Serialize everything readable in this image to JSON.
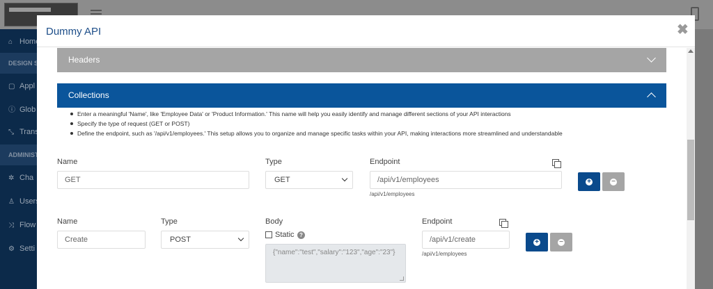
{
  "background": {
    "sidebar": {
      "items": [
        {
          "label": "Home",
          "icon": "home-icon"
        },
        {
          "label": "Appl",
          "icon": "app-icon"
        },
        {
          "label": "Glob",
          "icon": "globe-icon"
        },
        {
          "label": "Trans",
          "icon": "transform-icon"
        },
        {
          "label": "Cha",
          "icon": "gear-icon"
        },
        {
          "label": "Users",
          "icon": "user-icon"
        },
        {
          "label": "Flow",
          "icon": "shuffle-icon"
        },
        {
          "label": "Setti",
          "icon": "settings-icon"
        }
      ],
      "sections": [
        "DESIGN S",
        "ADMINIST"
      ]
    }
  },
  "modal": {
    "title": "Dummy API",
    "close": "✖",
    "accordions": {
      "headers": "Headers",
      "collections": "Collections"
    },
    "instructions": [
      "Enter a meaningful 'Name', like 'Employee Data' or 'Product Information.' This name will help you easily identify and manage different sections of your API interactions",
      "Specify the type of request (GET or POST)",
      "Define the endpoint, such as '/api/v1/employees.' This setup allows you to organize and manage specific tasks within your API, making interactions more streamlined and understandable"
    ],
    "row1": {
      "name_label": "Name",
      "name_value": "GET",
      "type_label": "Type",
      "type_value": "GET",
      "endpoint_label": "Endpoint",
      "endpoint_value": "/api/v1/employees",
      "endpoint_hint": "/api/v1/employees"
    },
    "row2": {
      "name_label": "Name",
      "name_value": "Create",
      "type_label": "Type",
      "type_value": "POST",
      "body_label": "Body",
      "static_label": "Static",
      "body_value": "{\"name\":\"test\",\"salary\":\"123\",\"age\":\"23\"}",
      "endpoint_label": "Endpoint",
      "endpoint_value": "/api/v1/create",
      "endpoint_hint": "/api/v1/employees"
    },
    "add_symbol": "+",
    "remove_symbol": "−",
    "help_symbol": "?"
  }
}
